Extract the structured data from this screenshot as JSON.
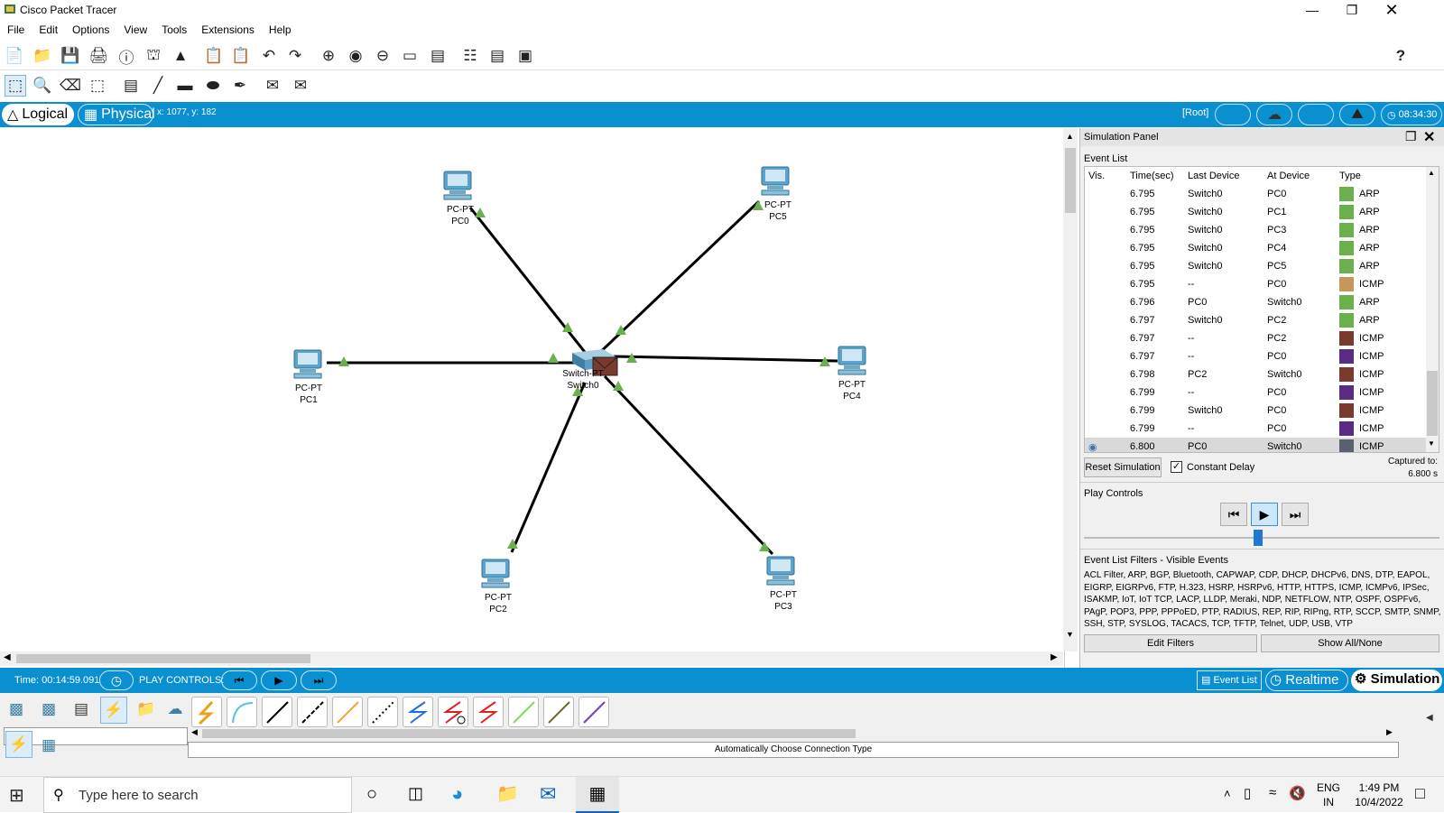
{
  "window": {
    "title": "Cisco Packet Tracer"
  },
  "menu": [
    "File",
    "Edit",
    "Options",
    "View",
    "Tools",
    "Extensions",
    "Help"
  ],
  "modebar": {
    "logical": "Logical",
    "physical": "Physical",
    "coords": "x: 1077, y: 182",
    "root": "[Root]",
    "clock": "08:34:30"
  },
  "topology": {
    "switch": {
      "model": "Switch-PT",
      "name": "Switch0"
    },
    "pcs": [
      {
        "model": "PC-PT",
        "name": "PC0"
      },
      {
        "model": "PC-PT",
        "name": "PC5"
      },
      {
        "model": "PC-PT",
        "name": "PC1"
      },
      {
        "model": "PC-PT",
        "name": "PC4"
      },
      {
        "model": "PC-PT",
        "name": "PC2"
      },
      {
        "model": "PC-PT",
        "name": "PC3"
      }
    ],
    "link_color": "#000000",
    "link_status_color": "#6ab04c"
  },
  "sim": {
    "title": "Simulation Panel",
    "event_list_label": "Event List",
    "columns": [
      "Vis.",
      "Time(sec)",
      "Last Device",
      "At Device",
      "Type"
    ],
    "events": [
      {
        "time": "6.795",
        "last": "Switch0",
        "at": "PC0",
        "type": "ARP",
        "color": "#6ab04c"
      },
      {
        "time": "6.795",
        "last": "Switch0",
        "at": "PC1",
        "type": "ARP",
        "color": "#6ab04c"
      },
      {
        "time": "6.795",
        "last": "Switch0",
        "at": "PC3",
        "type": "ARP",
        "color": "#6ab04c"
      },
      {
        "time": "6.795",
        "last": "Switch0",
        "at": "PC4",
        "type": "ARP",
        "color": "#6ab04c"
      },
      {
        "time": "6.795",
        "last": "Switch0",
        "at": "PC5",
        "type": "ARP",
        "color": "#6ab04c"
      },
      {
        "time": "6.795",
        "last": "--",
        "at": "PC0",
        "type": "ICMP",
        "color": "#c8965a"
      },
      {
        "time": "6.796",
        "last": "PC0",
        "at": "Switch0",
        "type": "ARP",
        "color": "#6ab04c"
      },
      {
        "time": "6.797",
        "last": "Switch0",
        "at": "PC2",
        "type": "ARP",
        "color": "#6ab04c"
      },
      {
        "time": "6.797",
        "last": "--",
        "at": "PC2",
        "type": "ICMP",
        "color": "#7a3b2e"
      },
      {
        "time": "6.797",
        "last": "--",
        "at": "PC0",
        "type": "ICMP",
        "color": "#5a2d82"
      },
      {
        "time": "6.798",
        "last": "PC2",
        "at": "Switch0",
        "type": "ICMP",
        "color": "#7a3b2e"
      },
      {
        "time": "6.799",
        "last": "--",
        "at": "PC0",
        "type": "ICMP",
        "color": "#5a2d82"
      },
      {
        "time": "6.799",
        "last": "Switch0",
        "at": "PC0",
        "type": "ICMP",
        "color": "#7a3b2e"
      },
      {
        "time": "6.799",
        "last": "--",
        "at": "PC0",
        "type": "ICMP",
        "color": "#5a2d82"
      },
      {
        "time": "6.800",
        "last": "PC0",
        "at": "Switch0",
        "type": "ICMP",
        "color": "#5b6070",
        "current": true
      }
    ],
    "reset_label": "Reset Simulation",
    "constant_delay_label": "Constant Delay",
    "captured_label": "Captured to:",
    "captured_value": "6.800 s",
    "play_controls_label": "Play Controls",
    "filters_title": "Event List Filters - Visible Events",
    "filters_text": "ACL Filter, ARP, BGP, Bluetooth, CAPWAP, CDP, DHCP, DHCPv6, DNS, DTP, EAPOL, EIGRP, EIGRPv6, FTP, H.323, HSRP, HSRPv6, HTTP, HTTPS, ICMP, ICMPv6, IPSec, ISAKMP, IoT, IoT TCP, LACP, LLDP, Meraki, NDP, NETFLOW, NTP, OSPF, OSPFv6, PAgP, POP3, PPP, PPPoED, PTP, RADIUS, REP, RIP, RIPng, RTP, SCCP, SMTP, SNMP, SSH, STP, SYSLOG, TACACS, TCP, TFTP, Telnet, UDP, USB, VTP",
    "edit_filters_label": "Edit Filters",
    "show_all_label": "Show All/None"
  },
  "bottombar": {
    "time": "Time: 00:14:59.091",
    "play_controls": "PLAY CONTROLS:",
    "event_list": "Event List",
    "realtime": "Realtime",
    "simulation": "Simulation"
  },
  "devpanel": {
    "connection_type": "Automatically Choose Connection Type",
    "search_value": ""
  },
  "taskbar": {
    "search_placeholder": "Type here to search",
    "lang1": "ENG",
    "lang2": "IN",
    "time": "1:49 PM",
    "date": "10/4/2022"
  },
  "colors": {
    "accent": "#0a8fd1",
    "pc_body": "#5ba3c9"
  }
}
